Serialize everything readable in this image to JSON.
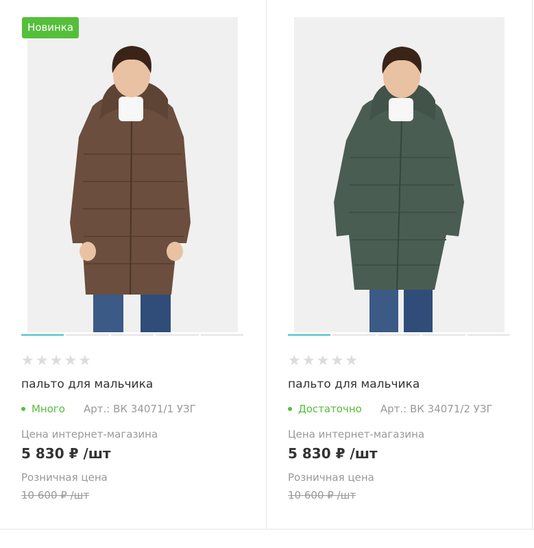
{
  "colors": {
    "badge_green": "#55bf3a",
    "availability_green": "#55bf3a",
    "slider_active": "#47c1c7",
    "coat_brown": "#6b4e3d",
    "coat_green": "#4a5d52"
  },
  "products": [
    {
      "badge": "Новинка",
      "image_icon": "brown-coat-photo",
      "slider": {
        "count": 5,
        "active": 0
      },
      "rating": {
        "value": 0,
        "max": 5
      },
      "title": "пальто для мальчика",
      "availability": "Много",
      "article": "Арт.: ВК 34071/1 УЗГ",
      "online_price_label": "Цена интернет-магазина",
      "online_price": "5 830 ₽ /шт",
      "retail_price_label": "Розничная цена",
      "retail_price": "10 600 ₽ /шт"
    },
    {
      "badge": "",
      "image_icon": "green-coat-photo",
      "slider": {
        "count": 5,
        "active": 0
      },
      "rating": {
        "value": 0,
        "max": 5
      },
      "title": "пальто для мальчика",
      "availability": "Достаточно",
      "article": "Арт.: ВК 34071/2 УЗГ",
      "online_price_label": "Цена интернет-магазина",
      "online_price": "5 830 ₽ /шт",
      "retail_price_label": "Розничная цена",
      "retail_price": "10 600 ₽ /шт"
    }
  ]
}
